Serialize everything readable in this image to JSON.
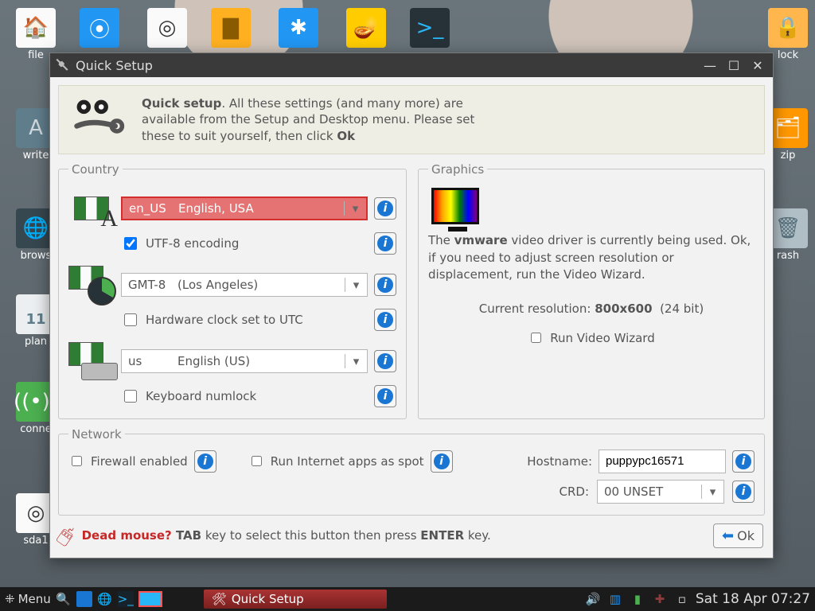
{
  "desktop_icons": {
    "file": "file",
    "help": "",
    "setup": "",
    "inst": "",
    "edit": "",
    "lamp": "",
    "term": "",
    "lock": "lock",
    "zip": "zip",
    "trash": "rash",
    "write": "write",
    "browse": "brows",
    "plan_num": "11",
    "plan": "plan",
    "connect": "conne",
    "sda": "sda1"
  },
  "window": {
    "title": "Quick Setup"
  },
  "intro": {
    "lead": "Quick setup",
    "text": ". All these settings (and many more) are available from the Setup and Desktop menu. Please set these to suit yourself, then click ",
    "ok": "Ok"
  },
  "country": {
    "legend": "Country",
    "locale": {
      "code": "en_US",
      "label": "English, USA"
    },
    "utf8": "UTF-8 encoding",
    "tz": {
      "code": "GMT-8",
      "label": "(Los Angeles)"
    },
    "hwclock": "Hardware clock set to UTC",
    "kb": {
      "code": "us",
      "label": "English (US)"
    },
    "numlock": "Keyboard numlock"
  },
  "graphics": {
    "legend": "Graphics",
    "line1a": "The ",
    "driver": "vmware",
    "line1b": " video driver is currently being used. Ok, if you need to adjust screen resolution or displacement, run the Video Wizard.",
    "res_label": "Current resolution: ",
    "res": "800x600",
    "depth": "(24 bit)",
    "wizard": "Run Video Wizard"
  },
  "network": {
    "legend": "Network",
    "firewall": "Firewall enabled",
    "spot": "Run Internet apps as spot",
    "host_label": "Hostname:",
    "host": "puppypc16571",
    "crd_label": "CRD:",
    "crd": "00 UNSET"
  },
  "footer": {
    "dead": "Dead mouse? ",
    "tab": "TAB",
    "mid": " key to select this button then press ",
    "enter": "ENTER",
    "tail": " key.",
    "ok": "Ok"
  },
  "taskbar": {
    "menu": "Menu",
    "task": "Quick Setup",
    "clock": "Sat 18 Apr 07:27"
  }
}
